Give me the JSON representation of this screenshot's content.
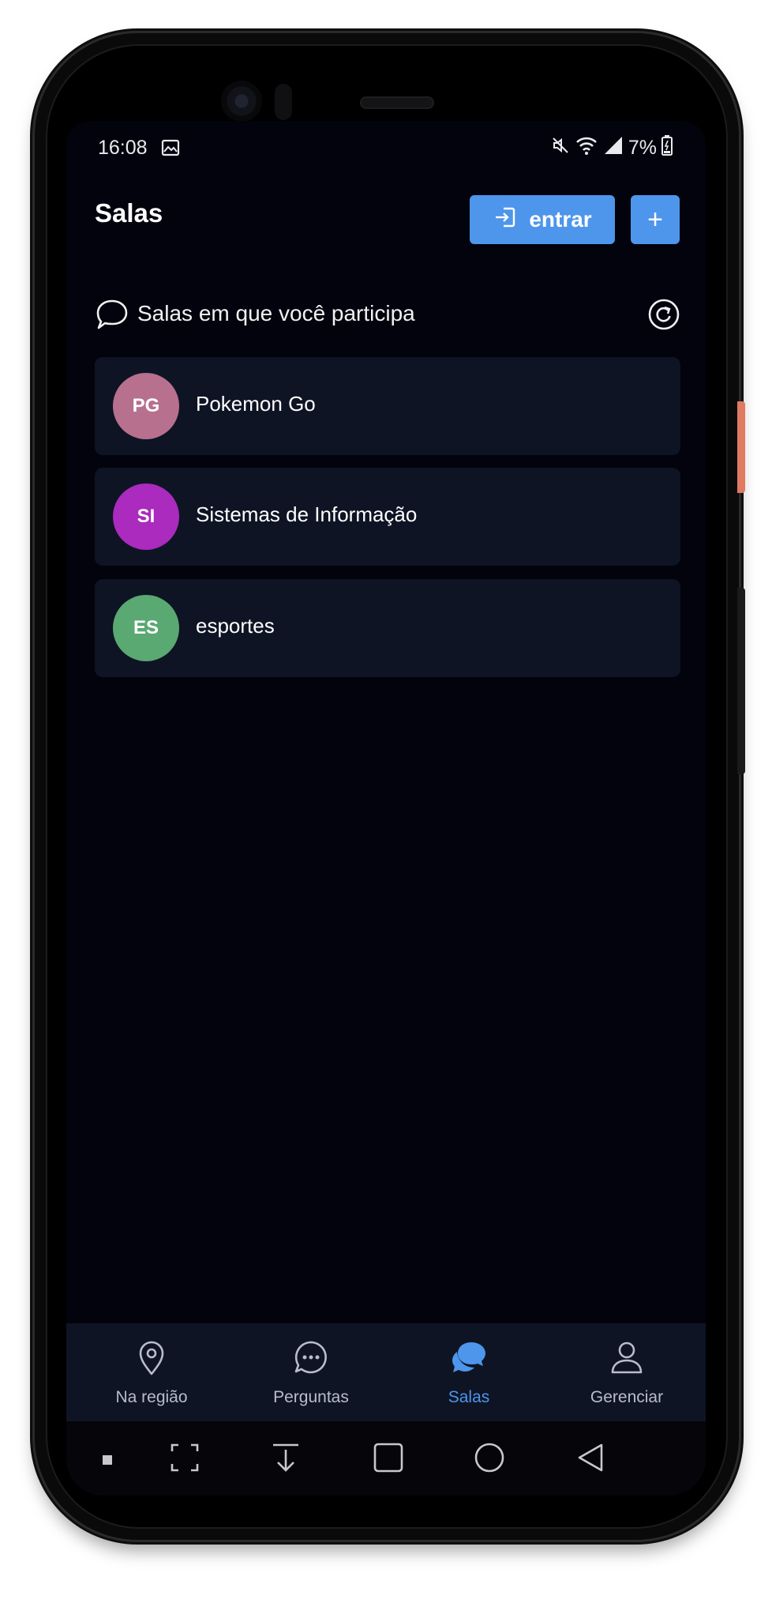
{
  "status_bar": {
    "time": "16:08",
    "battery": "7%"
  },
  "header": {
    "title": "Salas",
    "enter_label": "entrar",
    "add_label": "+"
  },
  "section": {
    "title": "Salas em que você participa"
  },
  "rooms": [
    {
      "initials": "PG",
      "name": "Pokemon Go",
      "color": "#b7708e"
    },
    {
      "initials": "SI",
      "name": "Sistemas de Informação",
      "color": "#aa2bbd"
    },
    {
      "initials": "ES",
      "name": "esportes",
      "color": "#5aa872"
    }
  ],
  "bottom_nav": {
    "active": "Salas",
    "items": [
      {
        "label": "Na região",
        "icon": "location-pin-icon"
      },
      {
        "label": "Perguntas",
        "icon": "chat-bubble-dots-icon"
      },
      {
        "label": "Salas",
        "icon": "chat-bubbles-icon"
      },
      {
        "label": "Gerenciar",
        "icon": "user-icon"
      }
    ]
  },
  "colors": {
    "accent": "#4e95ec",
    "background": "#02030c",
    "card": "#0e1424"
  }
}
